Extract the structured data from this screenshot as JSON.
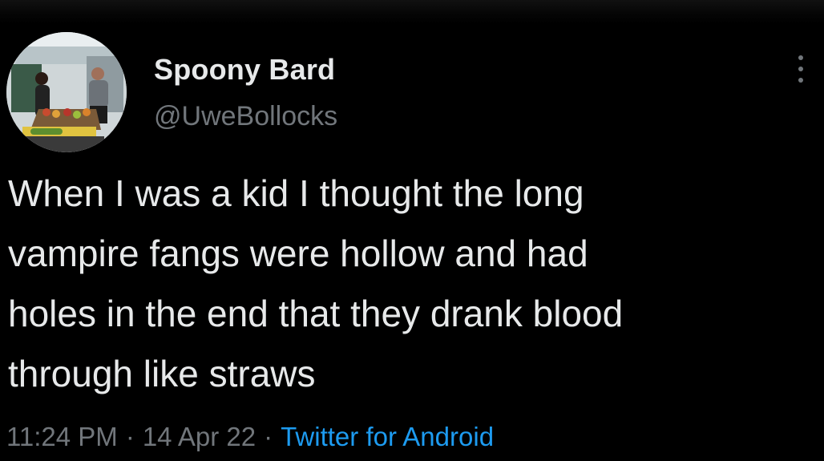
{
  "tweet": {
    "author": {
      "display_name": "Spoony Bard",
      "handle": "@UweBollocks",
      "avatar": "market-stall-photo-avatar"
    },
    "menu_icon": "more-vertical-icon",
    "text": "When I was a kid I thought the long\nvampire fangs were hollow and had\nholes in the end that they drank blood\nthrough like straws",
    "time": "11:24 PM",
    "separator": "·",
    "date": "14 Apr 22",
    "source": "Twitter for Android"
  },
  "colors": {
    "background": "#000000",
    "text_primary": "#e7e9ea",
    "text_secondary": "#71767b",
    "link": "#1d9bf0"
  }
}
